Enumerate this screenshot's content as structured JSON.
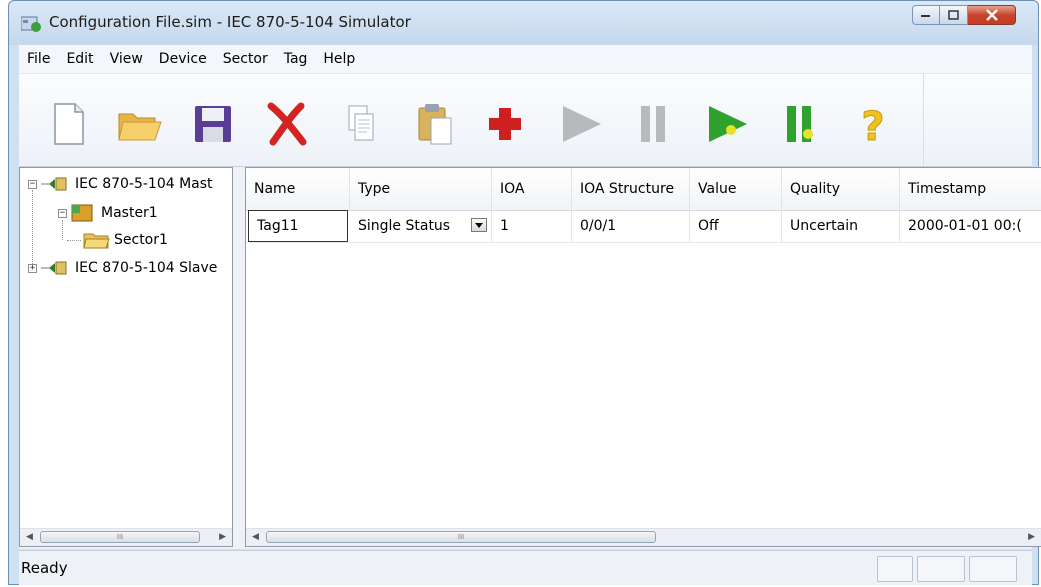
{
  "window": {
    "title": "Configuration File.sim - IEC 870-5-104 Simulator"
  },
  "menu": [
    "File",
    "Edit",
    "View",
    "Device",
    "Sector",
    "Tag",
    "Help"
  ],
  "toolbar": {
    "buttons": [
      "new-file",
      "open-folder",
      "save",
      "delete",
      "copy",
      "paste",
      "add",
      "run",
      "pause",
      "run-green",
      "pause-green",
      "help"
    ]
  },
  "tree": {
    "nodes": [
      {
        "label": "IEC 870-5-104 Mast",
        "expander": "−"
      },
      {
        "label": "Master1",
        "expander": "−"
      },
      {
        "label": "Sector1"
      },
      {
        "label": "IEC 870-5-104 Slave",
        "expander": "+"
      }
    ],
    "scroll_grip": "III"
  },
  "table": {
    "columns": [
      "Name",
      "Type",
      "IOA",
      "IOA Structure",
      "Value",
      "Quality",
      "Timestamp"
    ],
    "rows": [
      [
        "Tag11",
        "Single Status",
        "1",
        "0/0/1",
        "Off",
        "Uncertain",
        "2000-01-01 00:("
      ]
    ],
    "scroll_grip": "III"
  },
  "status": {
    "text": "Ready"
  }
}
